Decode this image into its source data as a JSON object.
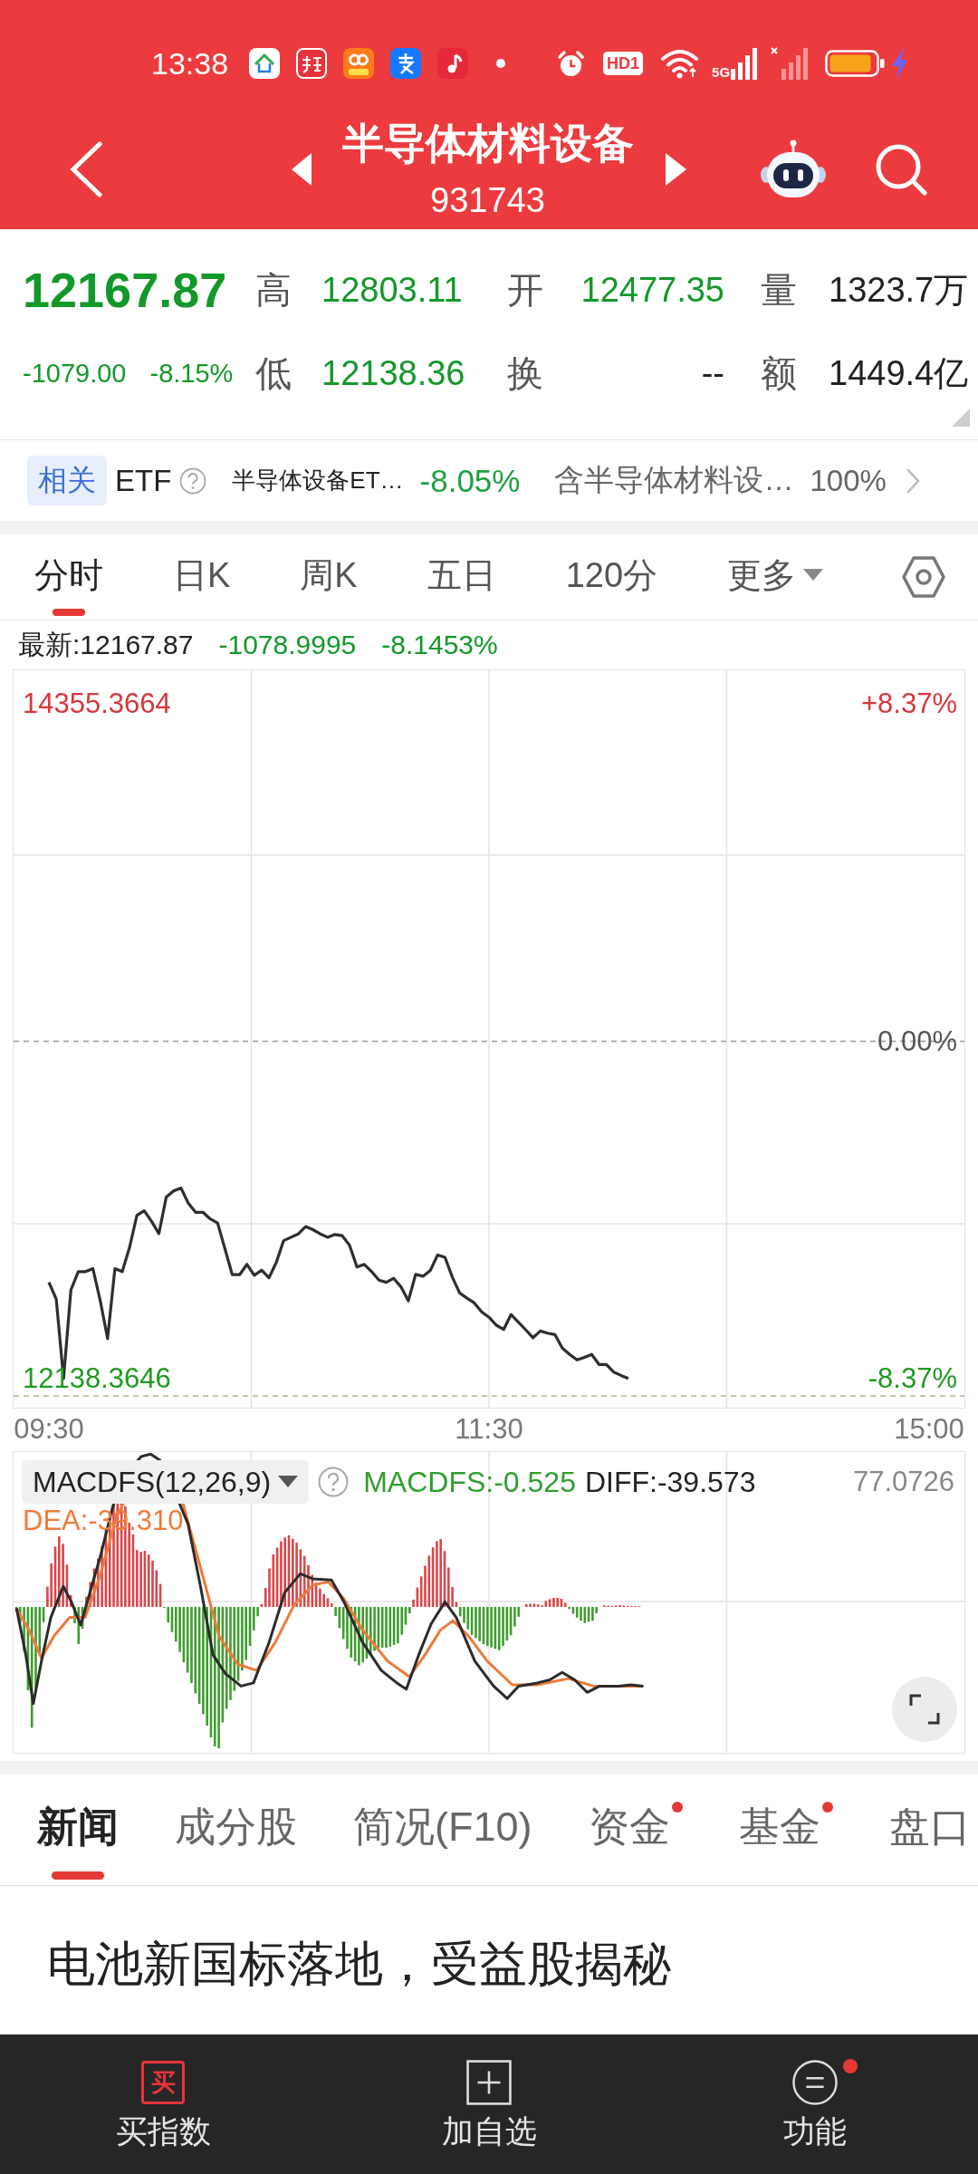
{
  "status_bar": {
    "time": "13:38",
    "hd_label": "HD1",
    "network_label": "5G"
  },
  "header": {
    "title": "半导体材料设备",
    "code": "931743"
  },
  "quote": {
    "price": "12167.87",
    "falling": true,
    "change": "-1079.00",
    "change_percent": "-8.15%",
    "rows": [
      {
        "fields": [
          {
            "label": "高",
            "value": "12803.11",
            "color": "#13982a"
          },
          {
            "label": "开",
            "value": "12477.35",
            "color": "#13982a"
          },
          {
            "label": "量",
            "value": "1323.7万",
            "color": "#222222"
          }
        ]
      },
      {
        "fields": [
          {
            "label": "低",
            "value": "12138.36",
            "color": "#13982a"
          },
          {
            "label": "换",
            "value": "--",
            "color": "#222222"
          },
          {
            "label": "额",
            "value": "1449.4亿",
            "color": "#222222"
          }
        ]
      }
    ]
  },
  "related_etf": {
    "tag": "相关",
    "label": "ETF",
    "fund": {
      "name": "半导体设备ET…",
      "change": "-8.05%",
      "falling": true
    },
    "holding_text": "含半导体材料设…",
    "holding_percent": "100%"
  },
  "chart_tabs": [
    {
      "label": "分时",
      "selected": true,
      "dropdown": false
    },
    {
      "label": "日K",
      "selected": false,
      "dropdown": false
    },
    {
      "label": "周K",
      "selected": false,
      "dropdown": false
    },
    {
      "label": "五日",
      "selected": false,
      "dropdown": false
    },
    {
      "label": "120分",
      "selected": false,
      "dropdown": false
    },
    {
      "label": "更多",
      "selected": false,
      "dropdown": true
    }
  ],
  "latest": {
    "text": "最新:12167.87",
    "change": "-1078.9995",
    "change_percent": "-8.1453%",
    "falling": true
  },
  "price_chart": {
    "chart_data": {
      "type": "line",
      "categories": [
        "09:30",
        null,
        null,
        null,
        null,
        null,
        null,
        null,
        null,
        null,
        null,
        null,
        null,
        null,
        null,
        null,
        null,
        null,
        null,
        null,
        null,
        null,
        null,
        null,
        null,
        null,
        null,
        null,
        null,
        null,
        null,
        null,
        null,
        null,
        null,
        null,
        null,
        null,
        null,
        null,
        null,
        null,
        null,
        null,
        null,
        null,
        null,
        null,
        null,
        null,
        null,
        null,
        null,
        null,
        null,
        null,
        null,
        null,
        null,
        null,
        "11:30",
        null,
        null,
        null,
        null,
        null,
        null,
        null,
        null,
        null,
        null,
        null,
        null,
        null,
        null,
        null,
        null,
        null,
        null,
        null,
        null,
        null,
        null,
        null,
        null,
        null,
        null,
        null,
        null,
        null,
        null,
        null,
        null,
        null,
        null,
        null,
        null,
        null,
        null,
        null,
        null,
        null,
        null,
        null,
        null,
        null,
        null,
        null,
        null,
        null,
        null,
        null,
        null,
        null,
        null,
        null,
        null,
        null,
        null,
        null,
        "15:00"
      ],
      "values": [
        12455,
        12400,
        12139,
        12430,
        12490,
        12490,
        12500,
        12395,
        12270,
        12500,
        12490,
        12570,
        12675,
        12690,
        12655,
        12615,
        12735,
        12755,
        12765,
        12715,
        12685,
        12685,
        12663,
        12650,
        12565,
        12480,
        12480,
        12514,
        12478,
        12495,
        12470,
        12520,
        12592,
        12603,
        12614,
        12638,
        12628,
        12614,
        12603,
        12612,
        12608,
        12576,
        12505,
        12514,
        12490,
        12462,
        12455,
        12468,
        12440,
        12394,
        12481,
        12475,
        12494,
        12545,
        12537,
        12472,
        12420,
        12403,
        12387,
        12358,
        12340,
        12314,
        12300,
        12349,
        12324,
        12299,
        12273,
        12295,
        12288,
        12283,
        12239,
        12218,
        12200,
        12208,
        12218,
        12185,
        12185,
        12160,
        12149,
        12139,
        null,
        null,
        null,
        null,
        null,
        null,
        null,
        null,
        null,
        null,
        null,
        null,
        null,
        null,
        null,
        null,
        null,
        null,
        null,
        null,
        null,
        null,
        null,
        null,
        null,
        null,
        null,
        null,
        null,
        null,
        null,
        null,
        null,
        null,
        null,
        null,
        null,
        null,
        null,
        null,
        null
      ],
      "ylim": [
        12138.3646,
        14355.3664
      ],
      "yticks": [
        {
          "value": 14355.3664,
          "label": "14355.3664"
        },
        {
          "value": 12138.3646,
          "label": "12138.3646"
        }
      ],
      "ref_lines": [
        {
          "axis": "y",
          "value": 13246.8655
        }
      ]
    },
    "right_axis_labels": [
      "+8.37%",
      "0.00%",
      "-8.37%"
    ]
  },
  "macd": {
    "indicator": "MACDFS(12,26,9)",
    "macdfs": "MACDFS:-0.525",
    "diff": "DIFF:-39.573",
    "dea": "DEA:-39.310",
    "scale": "77.0726"
  },
  "news_tabs": [
    {
      "label": "新闻",
      "selected": true,
      "badge": false
    },
    {
      "label": "成分股",
      "selected": false,
      "badge": false
    },
    {
      "label": "简况(F10)",
      "selected": false,
      "badge": false
    },
    {
      "label": "资金",
      "selected": false,
      "badge": true
    },
    {
      "label": "基金",
      "selected": false,
      "badge": true
    },
    {
      "label": "盘口",
      "selected": false,
      "badge": false
    }
  ],
  "news": {
    "headline": "电池新国标落地，受益股揭秘"
  },
  "bottom_bar": [
    {
      "kind": "buy",
      "icon_text": "买",
      "label": "买指数",
      "dot": false
    },
    {
      "kind": "add",
      "label": "加自选",
      "dot": false
    },
    {
      "kind": "menu",
      "label": "功能",
      "dot": true
    }
  ]
}
